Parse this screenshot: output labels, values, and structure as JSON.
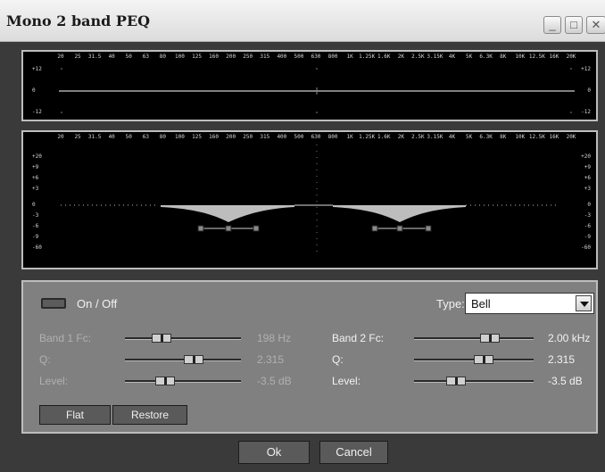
{
  "window": {
    "title": "Mono 2 band PEQ",
    "minimize_glyph": "_",
    "maximize_glyph": "□",
    "close_glyph": "✕"
  },
  "frequency_labels": [
    "20",
    "25",
    "31.5",
    "40",
    "50",
    "63",
    "80",
    "100",
    "125",
    "160",
    "200",
    "250",
    "315",
    "400",
    "500",
    "630",
    "800",
    "1K",
    "1.25K",
    "1.6K",
    "2K",
    "2.5K",
    "3.15K",
    "4K",
    "5K",
    "6.3K",
    "8K",
    "10K",
    "12.5K",
    "16K",
    "20K"
  ],
  "top_scale": {
    "db_labels": [
      "+12",
      "0",
      "-12"
    ]
  },
  "eq_scale": {
    "db_labels": [
      "+20",
      "+9",
      "+6",
      "+3",
      "0",
      "-3",
      "-6",
      "-9",
      "-60"
    ]
  },
  "on_off": {
    "label": "On / Off",
    "state": "off"
  },
  "type": {
    "label": "Type:",
    "value": "Bell"
  },
  "band1": {
    "fc_label": "Band 1 Fc:",
    "fc_value": "198 Hz",
    "q_label": "Q:",
    "q_value": "2.315",
    "level_label": "Level:",
    "level_value": "-3.5 dB"
  },
  "band2": {
    "fc_label": "Band 2 Fc:",
    "fc_value": "2.00 kHz",
    "q_label": "Q:",
    "q_value": "2.315",
    "level_label": "Level:",
    "level_value": "-3.5 dB"
  },
  "buttons": {
    "flat": "Flat",
    "restore": "Restore",
    "ok": "Ok",
    "cancel": "Cancel"
  },
  "colors": {
    "panel": "#808080",
    "display_bg": "#000000",
    "curve_fill": "#bdbdbd"
  }
}
